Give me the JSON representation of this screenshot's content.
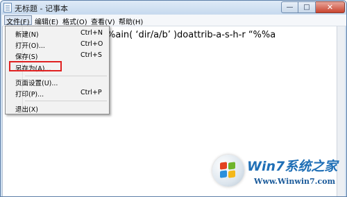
{
  "window": {
    "title": "无标题 - 记事本",
    "minimize_glyph": "—",
    "maximize_glyph": "□",
    "close_glyph": "✕"
  },
  "menubar": {
    "items": [
      {
        "label": "文件(F)"
      },
      {
        "label": "编辑(E)"
      },
      {
        "label": "格式(O)"
      },
      {
        "label": "查看(V)"
      },
      {
        "label": "帮助(H)"
      }
    ],
    "active_index": 0
  },
  "editor": {
    "visible_text": "%ain( ‘dir/a/b’ )doattrib-a-s-h-r “%%a"
  },
  "file_menu": {
    "items": [
      {
        "label": "新建(N)",
        "shortcut": "Ctrl+N"
      },
      {
        "label": "打开(O)...",
        "shortcut": "Ctrl+O"
      },
      {
        "label": "保存(S)",
        "shortcut": "Ctrl+S"
      },
      {
        "label": "另存为(A)...",
        "shortcut": ""
      },
      {
        "label": "页面设置(U)...",
        "shortcut": ""
      },
      {
        "label": "打印(P)...",
        "shortcut": "Ctrl+P"
      },
      {
        "label": "退出(X)",
        "shortcut": ""
      }
    ],
    "highlighted_item": "另存为(A)...",
    "highlight_color": "#e02020"
  },
  "watermark": {
    "title": "Win7系统之家",
    "url": "Www.Winwin7.com"
  },
  "colors": {
    "title_bar": "#c6d9ee",
    "close_button": "#c9442f",
    "menu_highlight_border": "#e02020"
  }
}
